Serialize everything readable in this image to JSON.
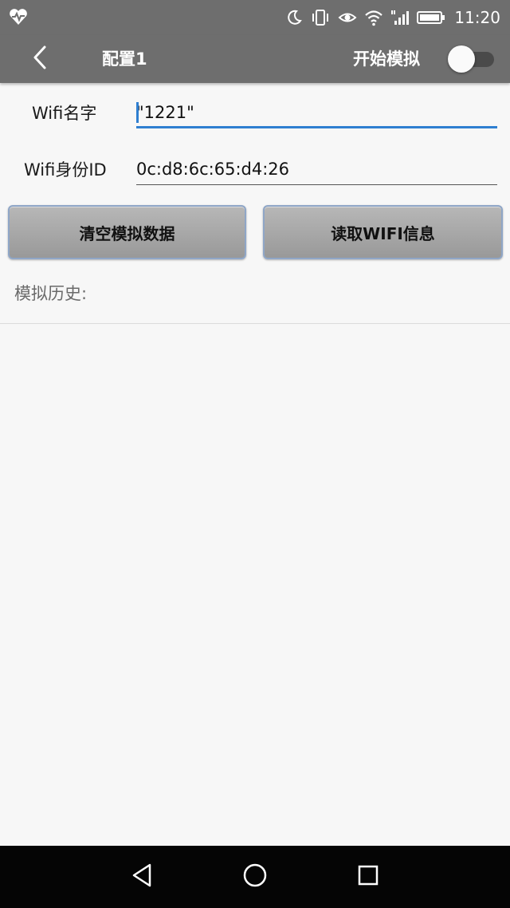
{
  "status_bar": {
    "time": "11:20",
    "icons": [
      "health-heart-icon",
      "moon-icon",
      "vibrate-icon",
      "eye-icon",
      "wifi-icon",
      "cell-signal-icon",
      "battery-icon"
    ]
  },
  "app_bar": {
    "title": "配置1",
    "simulate_label": "开始模拟",
    "simulate_on": false
  },
  "form": {
    "wifi_name_label": "Wifi名字",
    "wifi_name_value": "\"1221\"",
    "wifi_id_label": "Wifi身份ID",
    "wifi_id_value": "0c:d8:6c:65:d4:26"
  },
  "buttons": {
    "clear_label": "清空模拟数据",
    "read_label": "读取WIFI信息"
  },
  "history": {
    "label": "模拟历史:",
    "items": []
  },
  "colors": {
    "bar": "#6e6e6e",
    "accent": "#2f7fd1",
    "background": "#f7f7f7",
    "nav_bar": "#050505"
  }
}
